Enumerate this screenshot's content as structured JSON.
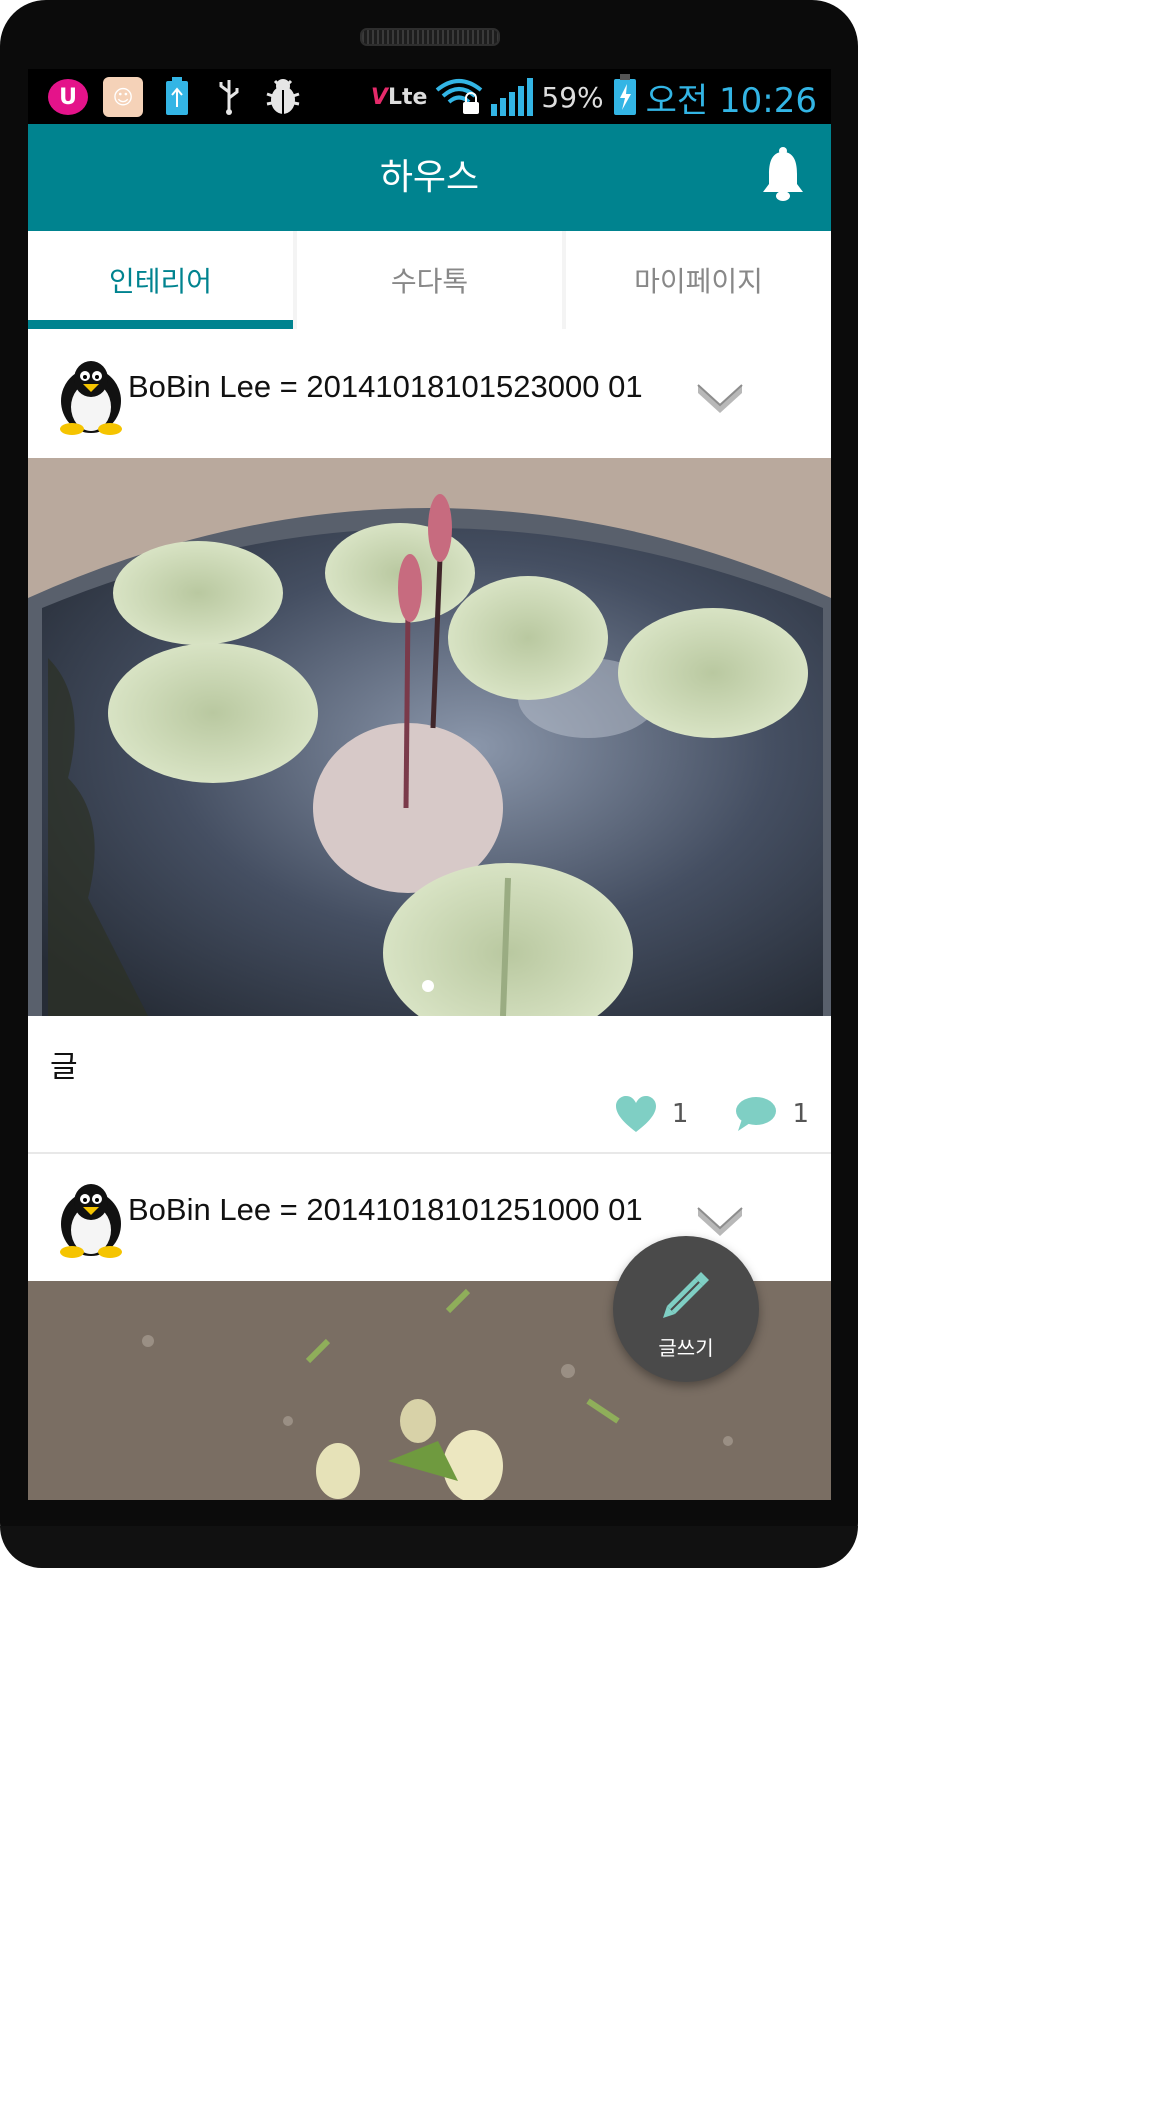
{
  "status_bar": {
    "volte_label": "Lte",
    "battery_percent": "59%",
    "time": "오전 10:26",
    "icons": [
      "uplus-icon",
      "kakao-icon",
      "battery-saver-icon",
      "usb-icon",
      "bug-icon",
      "volte-icon",
      "wifi-lock-icon",
      "signal-icon",
      "battery-charging-icon"
    ]
  },
  "app_bar": {
    "title": "하우스",
    "bell_icon": "bell-icon"
  },
  "tabs": [
    {
      "label": "인테리어",
      "active": true
    },
    {
      "label": "수다톡",
      "active": false
    },
    {
      "label": "마이페이지",
      "active": false
    }
  ],
  "posts": [
    {
      "author": "BoBin  Lee = 20141018101523000 01",
      "text": "글",
      "likes": "1",
      "comments": "1",
      "image_dots": 1
    },
    {
      "author": "BoBin  Lee = 20141018101251000 01"
    }
  ],
  "fab": {
    "label": "글쓰기",
    "icon": "pencil-icon"
  },
  "colors": {
    "accent": "#00838f",
    "heart": "#7fcfc4",
    "fab": "#4a4a4a"
  }
}
